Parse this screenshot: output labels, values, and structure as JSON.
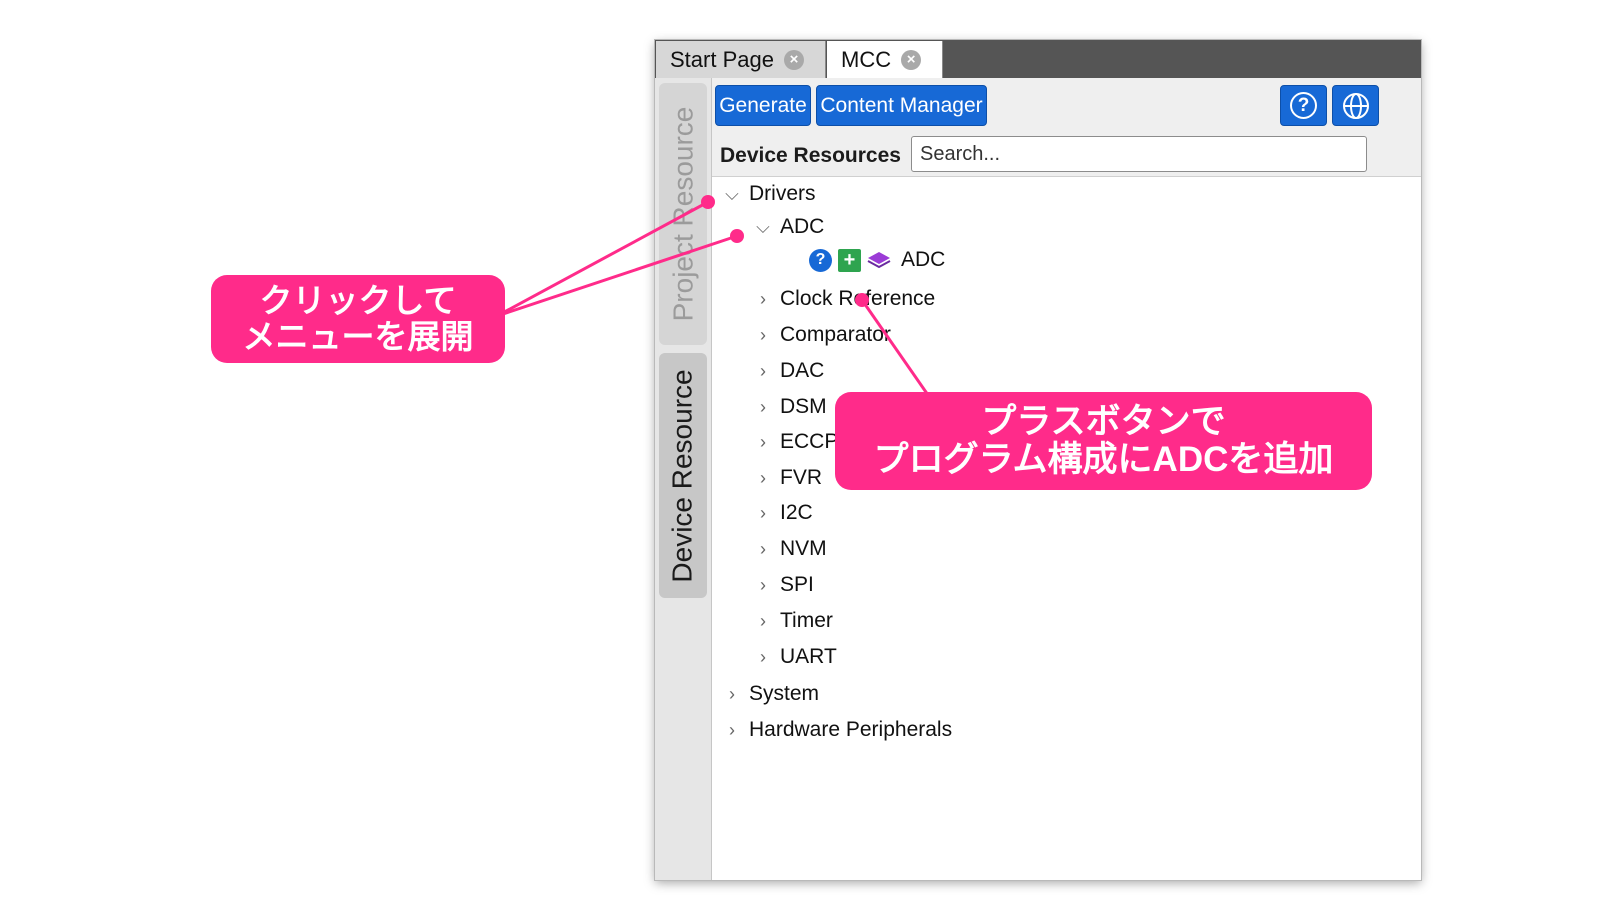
{
  "tabs": [
    {
      "label": "Start Page",
      "active": false
    },
    {
      "label": "MCC",
      "active": true
    }
  ],
  "sidebar": {
    "project_tab": "Project Resource",
    "device_tab": "Device Resource"
  },
  "toolbar": {
    "generate": "Generate",
    "content_manager": "Content Manager",
    "help_icon": "help-icon",
    "globe_icon": "globe-icon"
  },
  "resources": {
    "label": "Device Resources",
    "search_placeholder": "Search..."
  },
  "tree": {
    "drivers": "Drivers",
    "adc_group": "ADC",
    "adc_item": "ADC",
    "drivers_children": [
      "Clock Reference",
      "Comparator",
      "DAC",
      "DSM",
      "ECCP",
      "FVR",
      "I2C",
      "NVM",
      "SPI",
      "Timer",
      "UART"
    ],
    "system": "System",
    "hardware": "Hardware Peripherals"
  },
  "annotations": {
    "expand_line1": "クリックして",
    "expand_line2": "メニューを展開",
    "add_line1": "プラスボタンで",
    "add_line2": "プログラム構成にADCを追加"
  },
  "colors": {
    "accent": "#1769d6",
    "callout": "#ff2b8a",
    "add_button": "#2ea44f"
  }
}
